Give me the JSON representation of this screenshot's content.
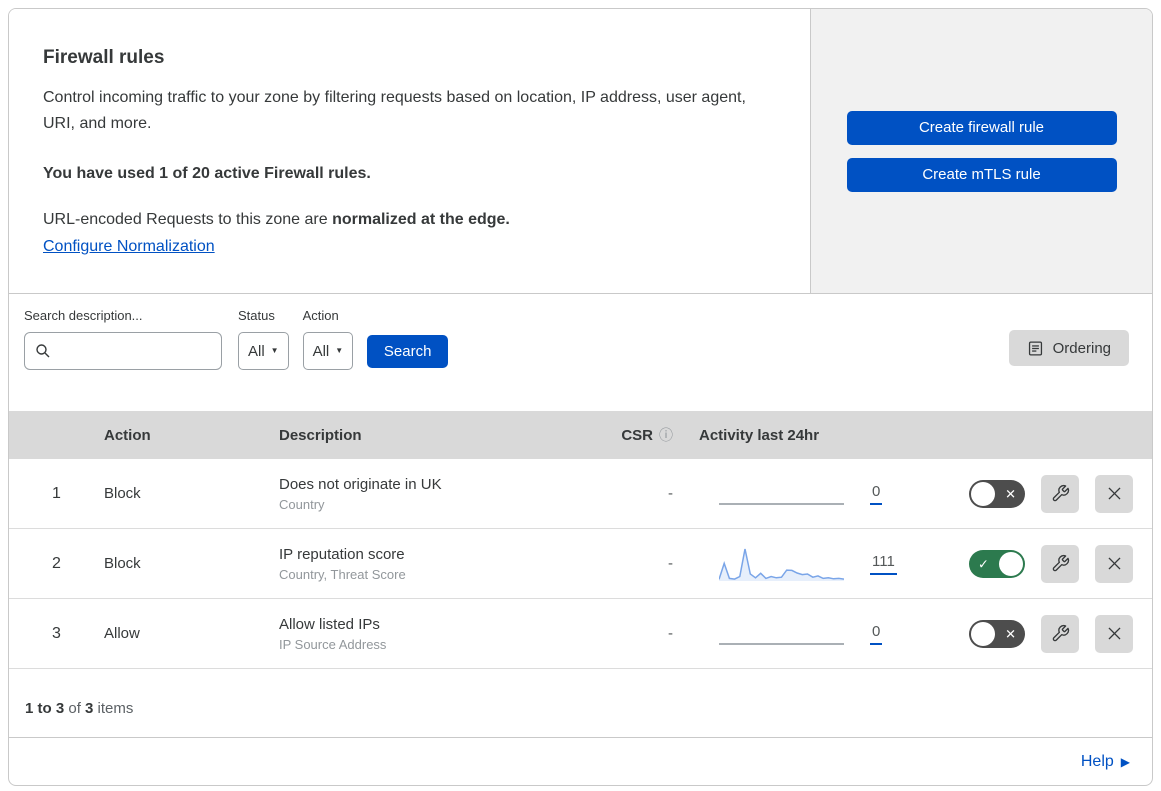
{
  "header": {
    "title": "Firewall rules",
    "description": "Control incoming traffic to your zone by filtering requests based on location, IP address, user agent, URI, and more.",
    "usage": "You have used 1 of 20 active Firewall rules.",
    "normalization_text": "URL-encoded Requests to this zone are ",
    "normalization_bold": "normalized at the edge.",
    "normalization_link": "Configure Normalization",
    "buttons": [
      {
        "label": "Create firewall rule"
      },
      {
        "label": "Create mTLS rule"
      }
    ]
  },
  "filters": {
    "search_label": "Search description...",
    "search_value": "",
    "status_label": "Status",
    "status_value": "All",
    "action_label": "Action",
    "action_value": "All",
    "search_button_label": "Search",
    "ordering_button_label": "Ordering"
  },
  "table": {
    "columns": {
      "action": "Action",
      "description": "Description",
      "csr": "CSR",
      "activity": "Activity last 24hr"
    },
    "rows": [
      {
        "priority": "1",
        "action": "Block",
        "description": "Does not originate in UK",
        "fields": "Country",
        "csr": "-",
        "count": "0",
        "enabled": false
      },
      {
        "priority": "2",
        "action": "Block",
        "description": "IP reputation score",
        "fields": "Country, Threat Score",
        "csr": "-",
        "count": "111",
        "enabled": true
      },
      {
        "priority": "3",
        "action": "Allow",
        "description": "Allow listed IPs",
        "fields": "IP Source Address",
        "csr": "-",
        "count": "0",
        "enabled": false
      }
    ]
  },
  "chart_data": {
    "type": "line",
    "title": "Activity last 24hr sparkline (rule 2)",
    "values": [
      5,
      55,
      8,
      6,
      14,
      100,
      22,
      10,
      24,
      8,
      14,
      10,
      12,
      34,
      33,
      25,
      20,
      22,
      12,
      16,
      8,
      10,
      7,
      8,
      6
    ],
    "total": 111,
    "xlabel": "",
    "ylabel": "",
    "legend": "none",
    "grid": false
  },
  "footer": {
    "range": "1 to 3",
    "of": " of ",
    "total": "3",
    "items_label": " items",
    "help_label": "Help"
  },
  "colors": {
    "accent_blue": "#0051c3",
    "toggle_on_green": "#2c7a4e",
    "toggle_off_grey": "#4d4d4d",
    "header_grey": "#d9d9d9",
    "panel_grey": "#f1f1f1",
    "sparkline_blue": "#7aa5e8"
  }
}
